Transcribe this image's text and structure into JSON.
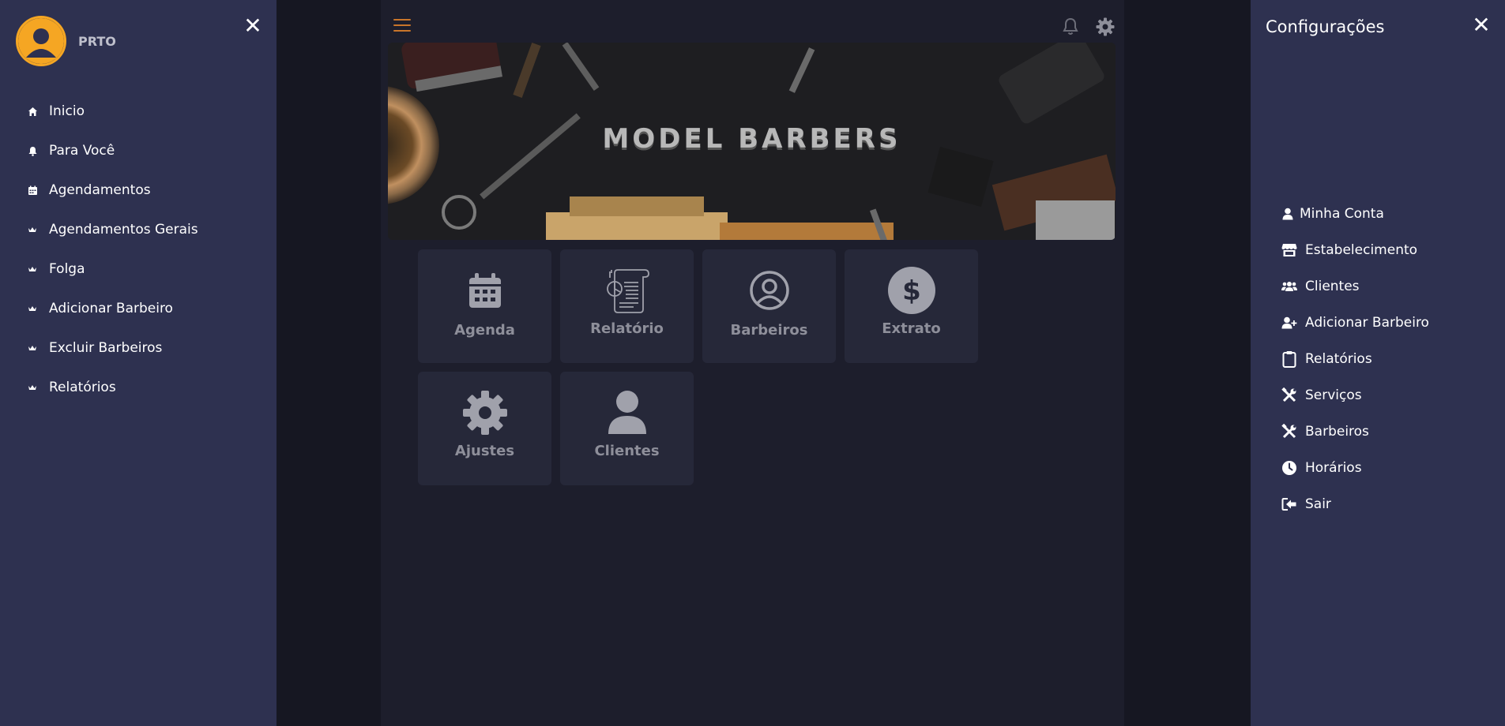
{
  "left_drawer": {
    "user_name": "PRTO",
    "close_label": "✕",
    "items": [
      {
        "label": "Inicio",
        "icon": "home-icon"
      },
      {
        "label": "Para Você",
        "icon": "bell-icon"
      },
      {
        "label": "Agendamentos",
        "icon": "calendar-icon"
      },
      {
        "label": "Agendamentos Gerais",
        "icon": "crown-icon"
      },
      {
        "label": "Folga",
        "icon": "crown-icon"
      },
      {
        "label": "Adicionar Barbeiro",
        "icon": "crown-icon"
      },
      {
        "label": "Excluir Barbeiros",
        "icon": "crown-icon"
      },
      {
        "label": "Relatórios",
        "icon": "crown-icon"
      }
    ]
  },
  "header": {
    "menu_icon": "hamburger-icon",
    "notification_icon": "bell-icon",
    "settings_icon": "gear-icon"
  },
  "banner": {
    "title": "MODEL BARBERS"
  },
  "tiles": [
    {
      "label": "Agenda",
      "icon": "calendar-icon"
    },
    {
      "label": "Relatório",
      "icon": "report-icon"
    },
    {
      "label": "Barbeiros",
      "icon": "user-circle-icon"
    },
    {
      "label": "Extrato",
      "icon": "dollar-circle-icon"
    },
    {
      "label": "Ajustes",
      "icon": "gear-icon"
    },
    {
      "label": "Clientes",
      "icon": "user-icon"
    }
  ],
  "right_drawer": {
    "title": "Configurações",
    "close_label": "✕",
    "items": [
      {
        "label": "Minha Conta",
        "icon": "user-icon"
      },
      {
        "label": "Estabelecimento",
        "icon": "store-icon"
      },
      {
        "label": "Clientes",
        "icon": "users-icon"
      },
      {
        "label": "Adicionar Barbeiro",
        "icon": "user-plus-icon"
      },
      {
        "label": "Relatórios",
        "icon": "clipboard-icon"
      },
      {
        "label": "Serviços",
        "icon": "tools-icon"
      },
      {
        "label": "Barbeiros",
        "icon": "tools-icon"
      },
      {
        "label": "Horários",
        "icon": "clock-icon"
      },
      {
        "label": "Sair",
        "icon": "logout-icon"
      }
    ]
  },
  "colors": {
    "accent": "#f5a623",
    "drawer_bg": "#2e3150",
    "main_bg": "#1d1e2c",
    "tile_bg": "#262839",
    "tile_text": "#8e8f9a"
  }
}
